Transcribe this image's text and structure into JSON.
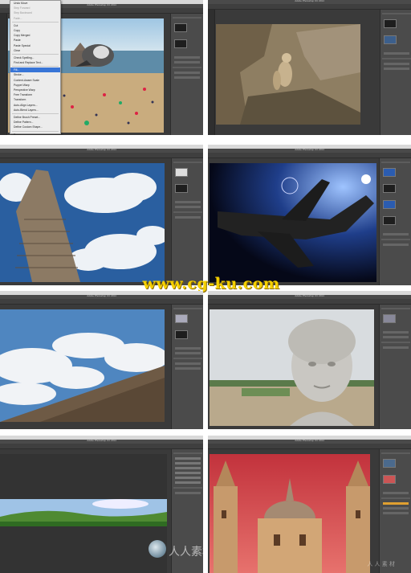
{
  "panels": [
    {
      "id": "seagull-beach",
      "title": "Adobe Photoshop CC 2014"
    },
    {
      "id": "squirrel-rock",
      "title": "Adobe Photoshop CC 2014"
    },
    {
      "id": "flatiron-sky",
      "title": "Adobe Photoshop CC 2014"
    },
    {
      "id": "airplane-glow",
      "title": "Adobe Photoshop CC 2014"
    },
    {
      "id": "clouds-slope",
      "title": "Adobe Photoshop CC 2014"
    },
    {
      "id": "statue-garden",
      "title": "Adobe Photoshop CC 2014"
    },
    {
      "id": "green-landscape",
      "title": "Adobe Photoshop CC 2014"
    },
    {
      "id": "basilica-sunset",
      "title": "Adobe Photoshop CC 2014"
    }
  ],
  "menu": {
    "items": [
      "Undo Move",
      "Step Forward",
      "Step Backward",
      "Fade...",
      "Cut",
      "Copy",
      "Copy Merged",
      "Paste",
      "Paste Special",
      "Clear",
      "Check Spelling...",
      "Find and Replace Text...",
      "Fill...",
      "Stroke...",
      "Content-Aware Scale",
      "Puppet Warp",
      "Perspective Warp",
      "Free Transform",
      "Transform",
      "Auto-Align Layers...",
      "Auto-Blend Layers...",
      "Define Brush Preset...",
      "Define Pattern...",
      "Define Custom Shape...",
      "Purge",
      "Adobe PDF Presets...",
      "Presets",
      "Remote Connections...",
      "Color Settings...",
      "Assign Profile..."
    ],
    "selected_index": 12
  },
  "watermark": "www.cg-ku.com",
  "logo_text": "人人素材",
  "ghost_text": "人 人 素 材",
  "colors": {
    "ps_dark": "#3a3a3a",
    "ps_panel": "#4b4b4b",
    "watermark": "#f5d000"
  }
}
